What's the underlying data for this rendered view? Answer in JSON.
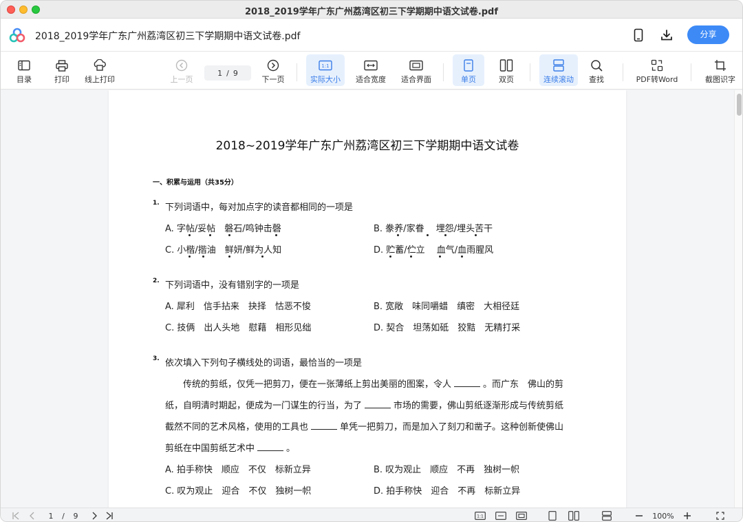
{
  "window": {
    "title": "2018_2019学年广东广州荔湾区初三下学期期中语文试卷.pdf"
  },
  "header": {
    "file_name": "2018_2019学年广东广州荔湾区初三下学期期中语文试卷.pdf",
    "share_label": "分享",
    "icons": [
      "app-logo",
      "phone-icon",
      "download-icon"
    ],
    "accent_color": "#3d8af7"
  },
  "toolbar": {
    "toc": "目录",
    "print": "打印",
    "online_print": "线上打印",
    "prev_page": "上一页",
    "current_page": "1",
    "separator": "/",
    "total_pages": "9",
    "next_page": "下一页",
    "actual_size": "实际大小",
    "fit_width": "适合宽度",
    "fit_page": "适合界面",
    "single_page": "单页",
    "double_page": "双页",
    "continuous_scroll": "连续滚动",
    "search": "查找",
    "pdf_to_word": "PDF转Word",
    "ocr": "截图识字",
    "actual_size_icon_text": "1:1"
  },
  "document": {
    "title": "2018~2019学年广东广州荔湾区初三下学期期中语文试卷",
    "section": "一、积累与运用（共35分）",
    "q1": {
      "num": "1.",
      "text": "下列词语中，每对加点字的读音都相同的一项是",
      "a": "A. 字帖/妥帖　磐石/鸣钟击磬",
      "b": "B. 豢养/家眷　 埋怨/埋头苦干",
      "c": "C. 小楷/揩油　鲜妍/鲜为人知",
      "d": "D. 贮蓄/伫立　 血气/血雨腥风"
    },
    "q2": {
      "num": "2.",
      "text": "下列词语中，没有错别字的一项是",
      "a": "A. 犀利　信手拈来　抉择　怙恶不悛",
      "b": "B. 宽敞　味同嚼蜡　缜密　大相径廷",
      "c": "C. 技俩　出人头地　慰藉　相形见绌",
      "d": "D. 契合　坦荡如砥　狡黠　无精打采"
    },
    "q3": {
      "num": "3.",
      "text": "依次填入下列句子横线处的词语，最恰当的一项是",
      "line1a": "传统的剪纸，仅凭一把剪刀，便在一张薄纸上剪出美丽的图案，令人",
      "line1b": "。而广东　佛山的剪",
      "line2a": "纸，自明清时期起，便成为一门谋生的行当，为了",
      "line2b": "市场的需要，佛山剪纸逐渐形成与传统剪纸",
      "line3a": "截然不同的艺术风格，使用的工具也",
      "line3b": "单凭一把剪刀，而是加入了刻刀和凿子。这种创新使佛山",
      "line4a": "剪纸在中国剪纸艺术中",
      "line4b": "。",
      "a": "A. 拍手称快　顺应　不仅　标新立异",
      "b": "B. 叹为观止　顺应　不再　独树一帜",
      "c": "C. 叹为观止　迎合　不仅　独树一帜",
      "d": "D. 拍手称快　迎合　不再　标新立异"
    }
  },
  "statusbar": {
    "current_page": "1",
    "separator": "/",
    "total_pages": "9",
    "zoom": "100%",
    "actual_size_icon_text": "1:1"
  }
}
